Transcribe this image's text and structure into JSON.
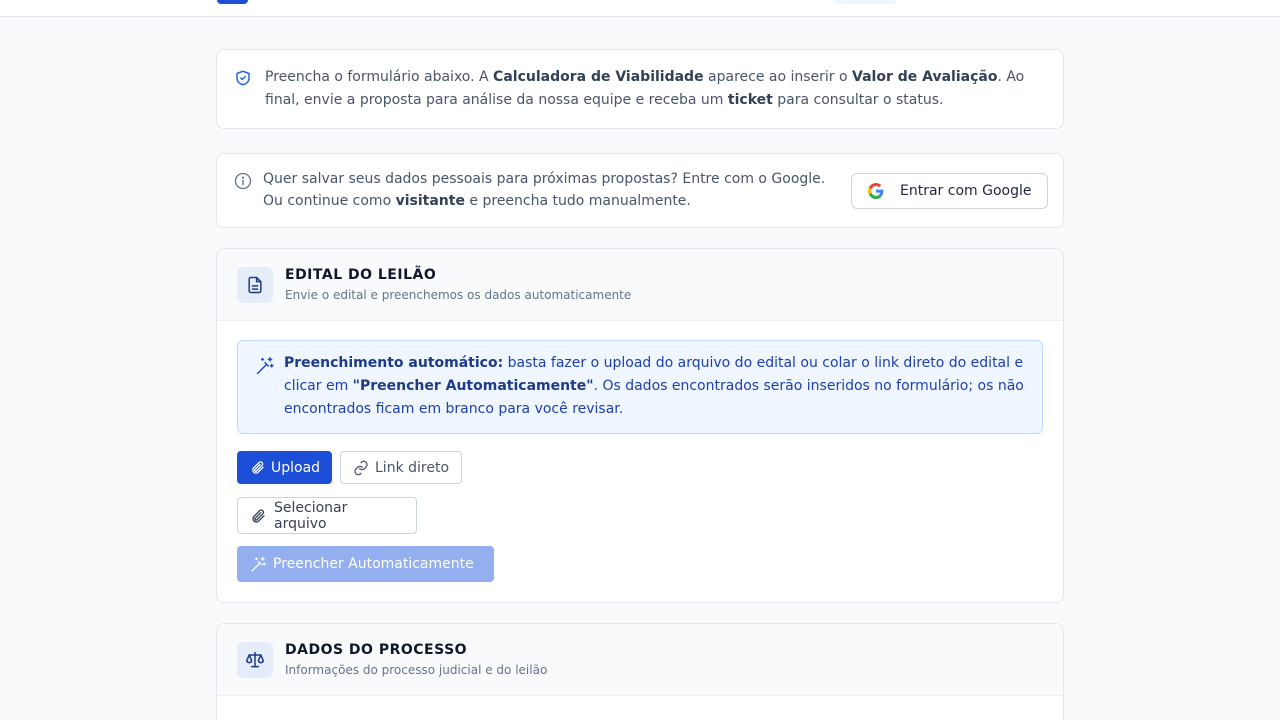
{
  "colors": {
    "primary": "#1d4ed8",
    "primary_disabled": "#93aff0",
    "callout_bg": "#eff6ff",
    "page_bg": "#f8fafc"
  },
  "intro": {
    "icon": "shield-check-icon",
    "t1": "Preencha o formulário abaixo. A ",
    "b1": "Calculadora de Viabilidade",
    "t2": " aparece ao inserir o ",
    "b2": "Valor de Avaliação",
    "t3": ". Ao final, envie a proposta para análise da nossa equipe e receba um ",
    "b3": "ticket",
    "t4": " para consultar o status."
  },
  "login": {
    "icon": "info-icon",
    "line1": "Quer salvar seus dados pessoais para próximas propostas? Entre com o Google.",
    "line2a": "Ou continue como ",
    "line2b": "visitante",
    "line2c": " e preencha tudo manualmente.",
    "button_label": "Entrar com Google",
    "button_icon": "google-icon"
  },
  "edital": {
    "icon": "document-icon",
    "title": "EDITAL DO LEILÃO",
    "subtitle": "Envie o edital e preenchemos os dados automaticamente",
    "callout": {
      "icon": "magic-wand-icon",
      "b1": "Preenchimento automático:",
      "t1": " basta fazer o upload do arquivo do edital ou colar o link direto do edital e clicar em ",
      "b2": "\"Preencher Automaticamente\"",
      "t2": ". Os dados encontrados serão inseridos no formulário; os não encontrados ficam em branco para você revisar."
    },
    "tabs": [
      {
        "label": "Upload",
        "icon": "paperclip-icon",
        "active": true
      },
      {
        "label": "Link direto",
        "icon": "link-icon",
        "active": false
      }
    ],
    "select_file_label": "Selecionar arquivo",
    "autofill_label": "Preencher Automaticamente"
  },
  "processo": {
    "icon": "scale-icon",
    "title": "DADOS DO PROCESSO",
    "subtitle": "Informações do processo judicial e do leilão"
  }
}
